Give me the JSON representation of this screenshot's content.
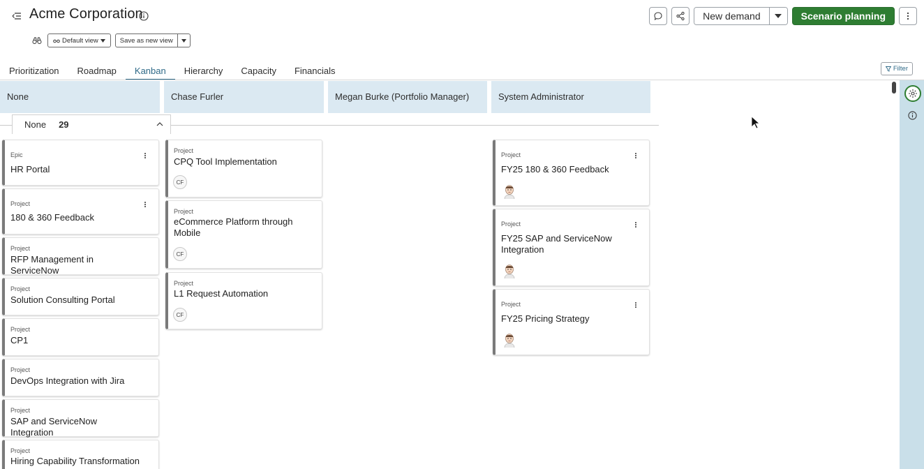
{
  "header": {
    "title": "Acme Corporation",
    "new_demand_label": "New demand",
    "scenario_label": "Scenario planning"
  },
  "view_bar": {
    "default_view_label": "Default view",
    "save_view_label": "Save as new view"
  },
  "tabs": [
    {
      "label": "Prioritization"
    },
    {
      "label": "Roadmap"
    },
    {
      "label": "Kanban",
      "active": true
    },
    {
      "label": "Hierarchy"
    },
    {
      "label": "Capacity"
    },
    {
      "label": "Financials"
    }
  ],
  "filter_label": "Filter",
  "columns": [
    {
      "label": "None"
    },
    {
      "label": "Chase Furler"
    },
    {
      "label": "Megan Burke (Portfolio Manager)"
    },
    {
      "label": "System Administrator"
    }
  ],
  "swimlane": {
    "label": "None",
    "count": "29"
  },
  "cards_col1": [
    {
      "type": "Epic",
      "name": "HR Portal"
    },
    {
      "type": "Project",
      "name": "180 & 360 Feedback"
    },
    {
      "type": "Project",
      "name": "RFP Management in ServiceNow"
    },
    {
      "type": "Project",
      "name": "Solution Consulting Portal"
    },
    {
      "type": "Project",
      "name": "CP1"
    },
    {
      "type": "Project",
      "name": "DevOps Integration with Jira"
    },
    {
      "type": "Project",
      "name": "SAP and ServiceNow Integration"
    },
    {
      "type": "Project",
      "name": "Hiring Capability Transformation"
    }
  ],
  "cards_col2": [
    {
      "type": "Project",
      "name": "CPQ Tool Implementation",
      "initials": "CF"
    },
    {
      "type": "Project",
      "name": "eCommerce Platform through Mobile",
      "initials": "CF"
    },
    {
      "type": "Project",
      "name": "L1 Request Automation",
      "initials": "CF"
    }
  ],
  "cards_col4": [
    {
      "type": "Project",
      "name": "FY25 180 & 360 Feedback"
    },
    {
      "type": "Project",
      "name": "FY25 SAP and ServiceNow Integration"
    },
    {
      "type": "Project",
      "name": "FY25 Pricing Strategy"
    }
  ],
  "colors": {
    "accent": "#2f6a88",
    "primary": "#2e7d32",
    "column_header_bg": "#dbe9f2",
    "rail_bg": "#c9dfe9"
  }
}
